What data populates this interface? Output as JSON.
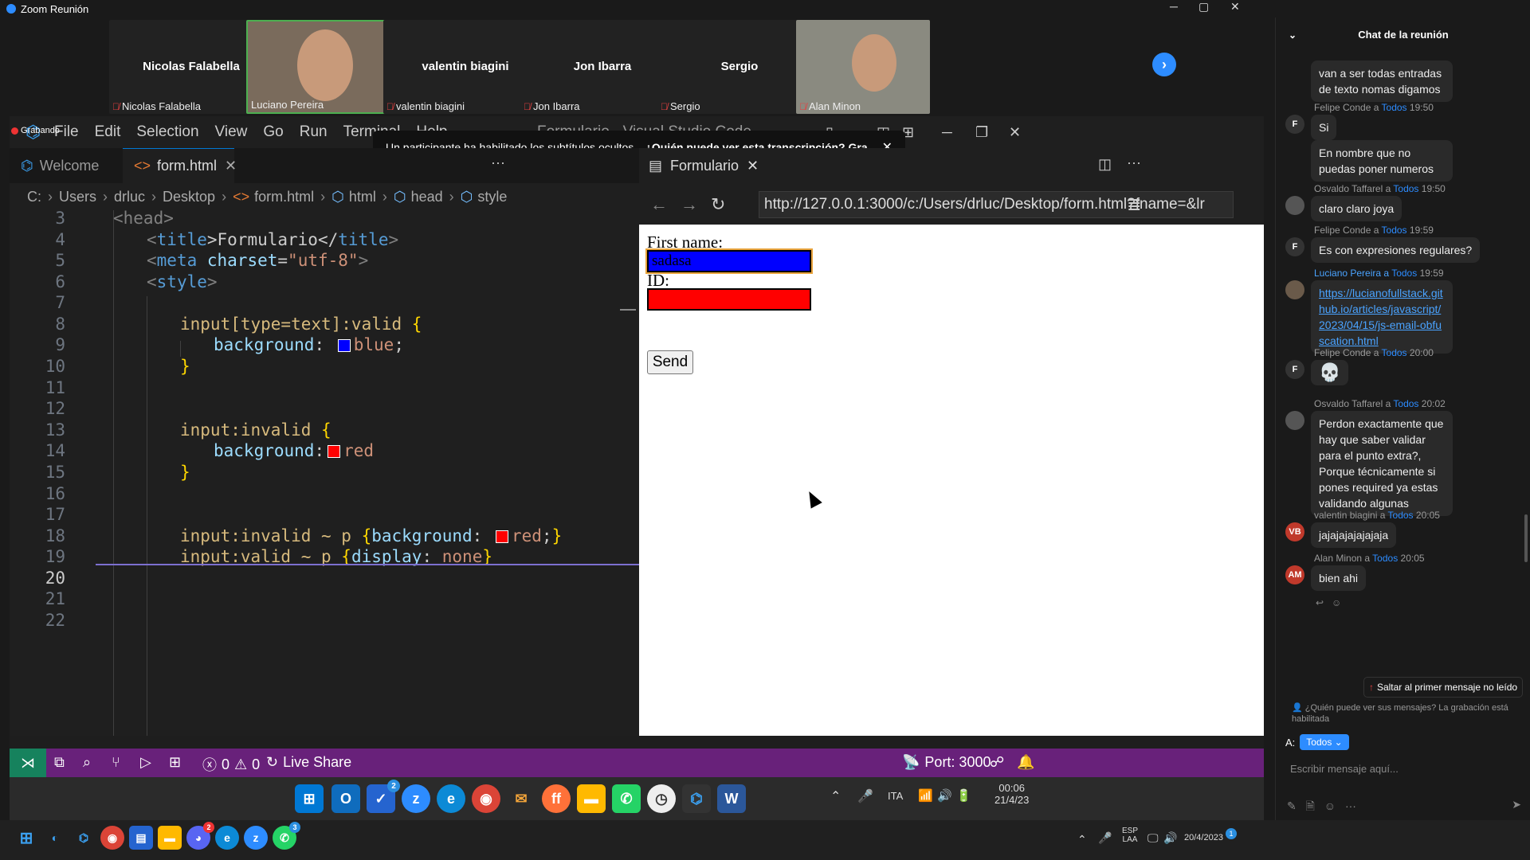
{
  "zoom": {
    "title": "Zoom Reunión",
    "participants": [
      {
        "name": "Nicolas Falabella",
        "label": "Nicolas Falabella"
      },
      {
        "name": "",
        "label": "Luciano Pereira"
      },
      {
        "name": "valentin biagini",
        "label": "valentin biagini"
      },
      {
        "name": "Jon Ibarra",
        "label": "Jon Ibarra"
      },
      {
        "name": "Sergio",
        "label": "Sergio"
      },
      {
        "name": "",
        "label": "Alan Minon"
      }
    ],
    "recording": "Grabando",
    "toast": {
      "text": "Un participante ha habilitado los subtítulos ocultos",
      "link": "¿Quién puede ver esta transcripción? Gra..."
    }
  },
  "vscode": {
    "menu": [
      "File",
      "Edit",
      "Selection",
      "View",
      "Go",
      "Run",
      "Terminal",
      "Help"
    ],
    "window_title": "Formulario - Visual Studio Code",
    "tabs": {
      "welcome": "Welcome",
      "form": "form.html"
    },
    "breadcrumb": [
      "C:",
      "Users",
      "drluc",
      "Desktop",
      "form.html",
      "html",
      "head",
      "style"
    ],
    "line_numbers": [
      "3",
      "4",
      "5",
      "6",
      "7",
      "8",
      "9",
      "10",
      "11",
      "12",
      "13",
      "14",
      "15",
      "16",
      "17",
      "18",
      "19",
      "20",
      "21",
      "22"
    ],
    "code": {
      "l3": "<head>",
      "l4a": "<",
      "l4b": "title",
      "l4c": ">Formulario</",
      "l4d": "title",
      "l4e": ">",
      "l5a": "<",
      "l5b": "meta",
      "l5c": " charset",
      "l5d": "=",
      "l5e": "\"utf-8\"",
      "l5f": ">",
      "l6a": "<",
      "l6b": "style",
      "l6c": ">",
      "l8a": "input[type=text]:valid ",
      "l8b": "{",
      "l9a": "background",
      "l9b": ": ",
      "l9c": "blue",
      "l9d": ";",
      "l10": "}",
      "l13a": "input:invalid ",
      "l13b": "{",
      "l14a": "background",
      "l14b": ":",
      "l14c": "red",
      "l15": "}",
      "l18a": "input:invalid ~ p ",
      "l18b": "{",
      "l18c": "background",
      "l18d": ": ",
      "l18e": "red",
      "l18f": ";",
      "l18g": "}",
      "l19a": "input:valid ~ p ",
      "l19b": "{",
      "l19c": "display",
      "l19d": ": ",
      "l19e": "none",
      "l19f": "}",
      "swatch_blue": "#0000ff",
      "swatch_red": "#ff0000"
    },
    "preview": {
      "tab": "Formulario",
      "url": "http://127.0.0.1:3000/c:/Users/drluc/Desktop/form.html?fname=&lr",
      "first_name_label": "First name:",
      "first_name_value": "sadasa",
      "id_label": "ID:",
      "id_value": "",
      "send": "Send"
    },
    "status": {
      "errors": "0",
      "warnings": "0",
      "live_share": "Live Share",
      "port": "Port: 3000"
    }
  },
  "taskbar_inner": {
    "badge": "2",
    "lang": "ITA",
    "time": "00:06",
    "date": "21/4/23"
  },
  "taskbar_outer": {
    "badge_discord": "2",
    "badge_whatsapp": "3",
    "lang1": "ESP",
    "lang2": "LAA",
    "date": "20/4/2023",
    "notif": "1"
  },
  "chat": {
    "title": "Chat de la reunión",
    "messages": [
      {
        "header": "",
        "to": "",
        "time": "",
        "text": "van a ser todas entradas de texto nomas digamos"
      },
      {
        "header": "Felipe Conde a ",
        "to": "Todos",
        "time": "19:50",
        "text": "Si"
      },
      {
        "header": "",
        "to": "",
        "time": "",
        "text": "En nombre que no puedas poner numeros"
      },
      {
        "header": "Osvaldo Taffarel a ",
        "to": "Todos",
        "time": "19:50",
        "text": "claro claro joya"
      },
      {
        "header": "Felipe Conde a ",
        "to": "Todos",
        "time": "19:59",
        "text": "Es con expresiones regulares?"
      },
      {
        "header": "Luciano Pereira a ",
        "to": "Todos",
        "time": "19:59",
        "text": "https://lucianofullstack.github.io/articles/javascript/2023/04/15/js-email-obfuscation.html"
      },
      {
        "header": "Felipe Conde a ",
        "to": "Todos",
        "time": "20:00",
        "text": "💀"
      },
      {
        "header": "Osvaldo Taffarel a ",
        "to": "Todos",
        "time": "20:02",
        "text": "Perdon exactamente que hay que saber validar para el punto extra?, Porque técnicamente si pones required ya estas validando algunas"
      },
      {
        "header": "valentin biagini a ",
        "to": "Todos",
        "time": "20:05",
        "text": "jajajajajajajaja"
      },
      {
        "header": "Alan Minon a ",
        "to": "Todos",
        "time": "20:05",
        "text": "bien ahi"
      }
    ],
    "avatars": {
      "f": "F",
      "vb": "VB",
      "am": "AM"
    },
    "jump": "Saltar al primer mensaje no leído",
    "privacy": "¿Quién puede ver sus mensajes? La grabación está habilitada",
    "to_label": "A:",
    "to_value": "Todos",
    "placeholder": "Escribir mensaje aquí..."
  }
}
